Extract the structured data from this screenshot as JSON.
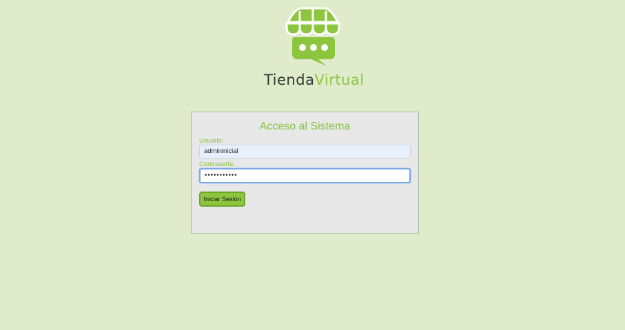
{
  "brand": {
    "name_part1": "Tienda",
    "name_part2": "Virtual",
    "logo_icon": "storefront-chat-icon",
    "colors": {
      "green": "#8cc63f",
      "dark": "#2e3a2e",
      "background": "#dfebcb"
    }
  },
  "login": {
    "title": "Acceso al Sistema",
    "username_label": "Usuario:",
    "username_value": "admininicial",
    "password_label": "Contraseña:",
    "password_value": "•••••••••••",
    "submit_label": "Iniciar Sesión"
  }
}
